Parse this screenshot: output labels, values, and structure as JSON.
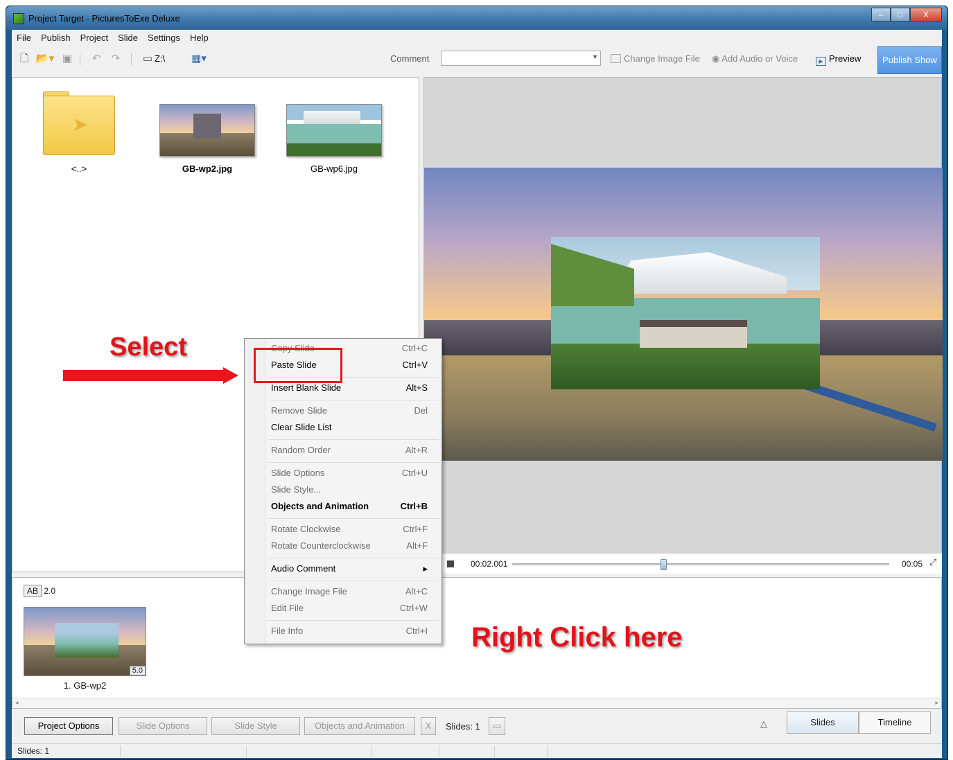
{
  "window": {
    "title": "Project Target - PicturesToExe Deluxe",
    "buttons": [
      "–",
      "□",
      "X"
    ]
  },
  "menubar": [
    "File",
    "Publish",
    "Project",
    "Slide",
    "Settings",
    "Help"
  ],
  "toolbar": {
    "drive": "Z:\\",
    "comment_label": "Comment",
    "comment_value": "",
    "change_image_file": "Change Image File",
    "add_audio": "Add Audio or Voice",
    "preview": "Preview",
    "publish_show": "Publish Show"
  },
  "file_browser": {
    "items": [
      {
        "name": "<..>",
        "type": "folder",
        "bold": false
      },
      {
        "name": "GB-wp2.jpg",
        "type": "image",
        "bold": true
      },
      {
        "name": "GB-wp6.jpg",
        "type": "image",
        "bold": false
      }
    ]
  },
  "player": {
    "time_current": "00:02.001",
    "time_end": "00:05",
    "position": 0.4
  },
  "slide_list": {
    "transition": "AB",
    "transition_duration": "2.0",
    "slides": [
      {
        "caption": "1. GB-wp2",
        "duration": "5.0"
      }
    ]
  },
  "context_menu": {
    "items": [
      {
        "label": "Copy Slide",
        "shortcut": "Ctrl+C",
        "style": "dim"
      },
      {
        "label": "Paste Slide",
        "shortcut": "Ctrl+V",
        "style": "normal"
      },
      {
        "label": "Insert Blank Slide",
        "shortcut": "Alt+S",
        "style": "bold"
      },
      {
        "label": "Remove Slide",
        "shortcut": "Del",
        "style": "dim"
      },
      {
        "label": "Clear Slide List",
        "shortcut": "",
        "style": "normal"
      },
      {
        "label": "Random Order",
        "shortcut": "Alt+R",
        "style": "dim"
      },
      {
        "label": "Slide Options",
        "shortcut": "Ctrl+U",
        "style": "dim"
      },
      {
        "label": "Slide Style...",
        "shortcut": "",
        "style": "dim"
      },
      {
        "label": "Objects and Animation",
        "shortcut": "Ctrl+B",
        "style": "bold"
      },
      {
        "label": "Rotate Clockwise",
        "shortcut": "Ctrl+F",
        "style": "dim"
      },
      {
        "label": "Rotate Counterclockwise",
        "shortcut": "Alt+F",
        "style": "dim"
      },
      {
        "label": "Audio Comment",
        "shortcut": "▸",
        "style": "normal"
      },
      {
        "label": "Change Image File",
        "shortcut": "Alt+C",
        "style": "dim"
      },
      {
        "label": "Edit File",
        "shortcut": "Ctrl+W",
        "style": "dim"
      },
      {
        "label": "File Info",
        "shortcut": "Ctrl+I",
        "style": "dim"
      }
    ]
  },
  "bottom_bar": {
    "project_options": "Project Options",
    "slide_options": "Slide Options",
    "slide_style": "Slide Style",
    "objects_animation": "Objects and Animation",
    "x": "X",
    "slides_count": "Slides: 1",
    "tab_slides": "Slides",
    "tab_timeline": "Timeline"
  },
  "status_bar": {
    "text": "Slides: 1"
  },
  "annotations": {
    "select": "Select",
    "right_click": "Right Click here"
  },
  "colors": {
    "annotation_red": "#e0141b",
    "publish_blue": "#5294e2"
  }
}
